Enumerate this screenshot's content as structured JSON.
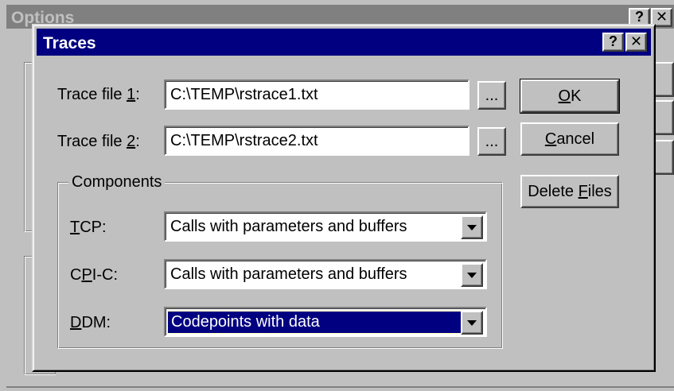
{
  "back_window": {
    "title": "Options",
    "help_label": "?",
    "close_label": "✕"
  },
  "dialog": {
    "title": "Traces",
    "help_label": "?",
    "close_label": "✕",
    "trace_file_1": {
      "label": "Trace file 1:",
      "value": "C:\\TEMP\\rstrace1.txt",
      "browse_label": "..."
    },
    "trace_file_2": {
      "label": "Trace file 2:",
      "value": "C:\\TEMP\\rstrace2.txt",
      "browse_label": "..."
    },
    "buttons": {
      "ok": "OK",
      "cancel": "Cancel",
      "delete_files": "Delete Files"
    },
    "components": {
      "legend": "Components",
      "tcp": {
        "label": "TCP:",
        "value": "Calls with parameters and buffers"
      },
      "cpic": {
        "label": "CPI-C:",
        "value": "Calls with parameters and buffers"
      },
      "ddm": {
        "label": "DDM:",
        "value": "Codepoints with data"
      }
    }
  },
  "colors": {
    "titlebar_active": "#000080",
    "titlebar_inactive": "#808080",
    "face": "#c0c0c0",
    "selection": "#000080"
  }
}
